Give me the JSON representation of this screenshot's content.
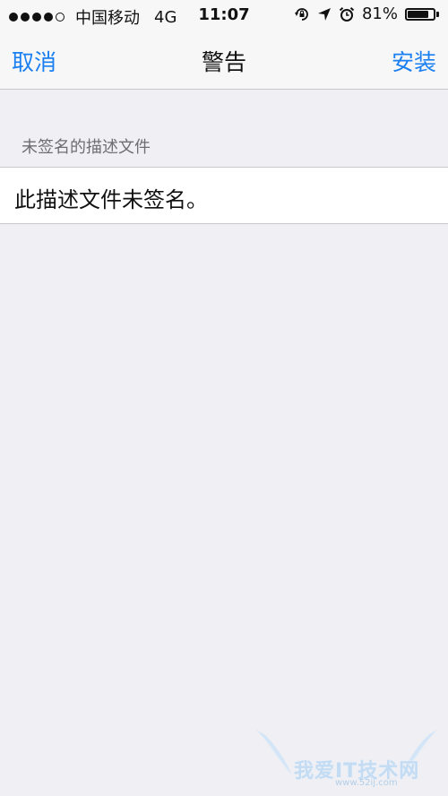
{
  "status_bar": {
    "carrier": "中国移动",
    "network": "4G",
    "time": "11:07",
    "battery_percent_text": "81%",
    "battery_level": 0.81,
    "signal_bars_filled": 4,
    "signal_bars_total": 5,
    "icons": [
      "rotation-lock-icon",
      "location-arrow-icon",
      "alarm-clock-icon",
      "battery-icon"
    ]
  },
  "nav": {
    "cancel_label": "取消",
    "title": "警告",
    "install_label": "安装"
  },
  "section": {
    "header": "未签名的描述文件",
    "cell_text": "此描述文件未签名。"
  },
  "watermark": {
    "text": "我爱IT技术网",
    "url": "www.52ij.com"
  },
  "colors": {
    "accent": "#1a7ff0",
    "background": "#efeff4",
    "bar_background": "#f7f7f8",
    "separator": "#c8c7cc",
    "section_header_text": "#6d6d72"
  }
}
